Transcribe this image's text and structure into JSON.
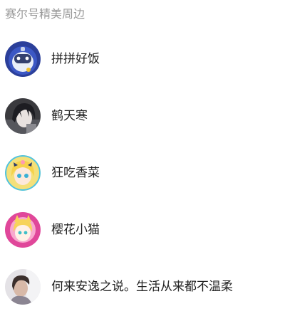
{
  "section": {
    "title": "赛尔号精美周边"
  },
  "users": [
    {
      "name": "拼拼好饭",
      "avatar_icon": "robot-mascot-avatar",
      "avatar_bg": "#2b3f9a"
    },
    {
      "name": "鹤天寒",
      "avatar_icon": "dark-haired-character-avatar",
      "avatar_bg": "#3a3a3e"
    },
    {
      "name": "狂吃香菜",
      "avatar_icon": "blonde-anime-girl-avatar",
      "avatar_bg": "#f4e07a"
    },
    {
      "name": "樱花小猫",
      "avatar_icon": "pink-cat-girl-avatar",
      "avatar_bg": "#e0479a"
    },
    {
      "name": "何来安逸之说。生活从来都不温柔",
      "avatar_icon": "person-photo-avatar",
      "avatar_bg": "#cfc6c8"
    }
  ]
}
